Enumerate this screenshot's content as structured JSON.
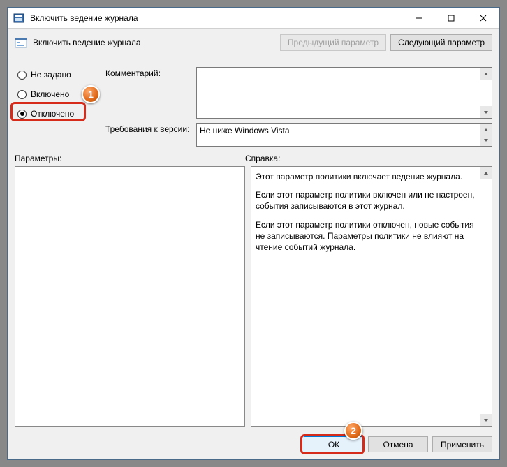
{
  "window": {
    "title": "Включить ведение журнала"
  },
  "header": {
    "policy_title": "Включить ведение журнала",
    "prev_button": "Предыдущий параметр",
    "next_button": "Следующий параметр"
  },
  "radios": {
    "not_configured": "Не задано",
    "enabled": "Включено",
    "disabled": "Отключено"
  },
  "labels": {
    "comment": "Комментарий:",
    "requirements": "Требования к версии:",
    "options": "Параметры:",
    "help": "Справка:"
  },
  "fields": {
    "comment": "",
    "requirements": "Не ниже Windows Vista"
  },
  "help": {
    "p1": "Этот параметр политики включает ведение журнала.",
    "p2": "Если этот параметр политики включен или не настроен, события записываются в этот журнал.",
    "p3": "Если этот параметр политики отключен, новые события не записываются. Параметры политики не влияют на чтение событий журнала."
  },
  "buttons": {
    "ok": "ОК",
    "cancel": "Отмена",
    "apply": "Применить"
  },
  "badges": {
    "one": "1",
    "two": "2"
  }
}
